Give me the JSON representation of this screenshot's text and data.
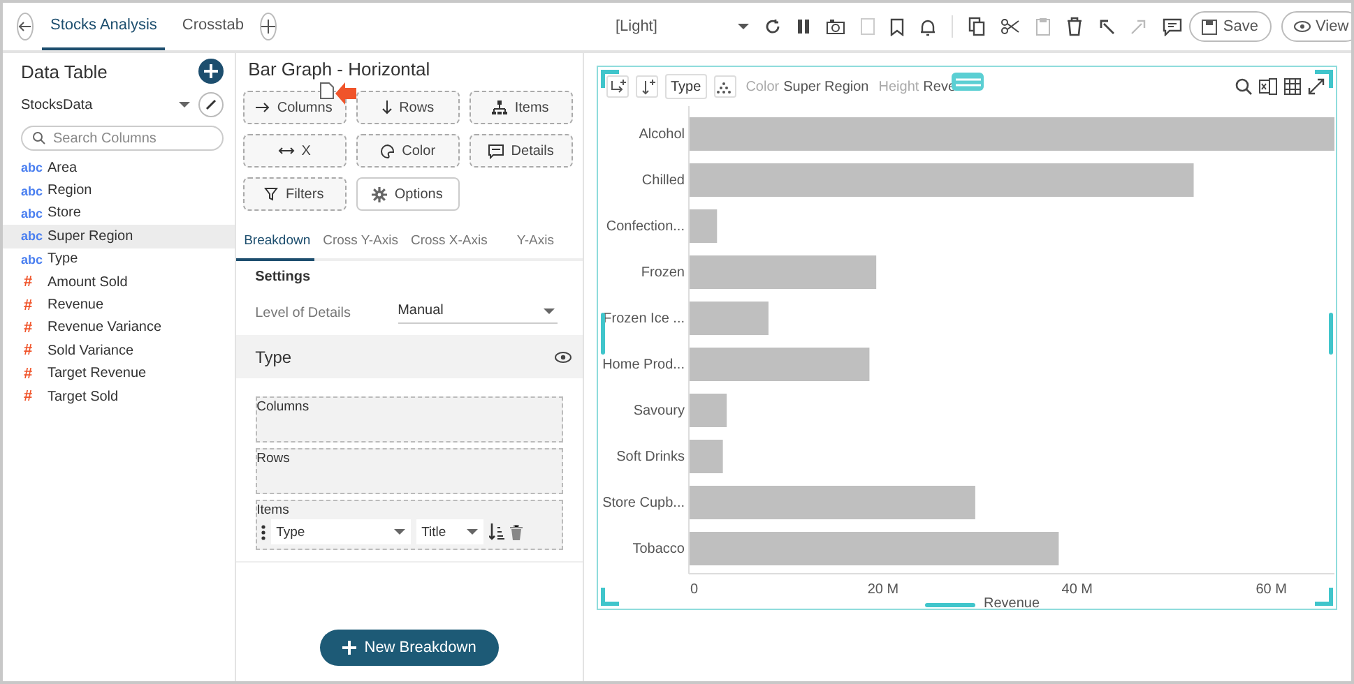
{
  "top_bar": {
    "tabs": [
      {
        "label": "Stocks Analysis",
        "selected": true
      },
      {
        "label": "Crosstab",
        "selected": false
      }
    ],
    "theme": "[Light]",
    "save": "Save",
    "view": "View"
  },
  "data_table": {
    "title": "Data Table",
    "source": "StocksData",
    "search": {
      "placeholder": "Search Columns"
    },
    "columns": [
      {
        "tag": "abc",
        "kind": "text",
        "name": "Area",
        "selected": false
      },
      {
        "tag": "abc",
        "kind": "text",
        "name": "Region",
        "selected": false
      },
      {
        "tag": "abc",
        "kind": "text",
        "name": "Store",
        "selected": false
      },
      {
        "tag": "abc",
        "kind": "text",
        "name": "Super Region",
        "selected": true
      },
      {
        "tag": "abc",
        "kind": "text",
        "name": "Type",
        "selected": false
      },
      {
        "tag": "#",
        "kind": "numeric",
        "name": "Amount Sold",
        "selected": false
      },
      {
        "tag": "#",
        "kind": "numeric",
        "name": "Revenue",
        "selected": false
      },
      {
        "tag": "#",
        "kind": "numeric",
        "name": "Revenue Variance",
        "selected": false
      },
      {
        "tag": "#",
        "kind": "numeric",
        "name": "Sold Variance",
        "selected": false
      },
      {
        "tag": "#",
        "kind": "numeric",
        "name": "Target Revenue",
        "selected": false
      },
      {
        "tag": "#",
        "kind": "numeric",
        "name": "Target Sold",
        "selected": false
      }
    ]
  },
  "editor": {
    "title": "Bar Graph - Horizontal",
    "drop_buttons": [
      {
        "label": "Columns",
        "kind": "drop"
      },
      {
        "label": "Rows",
        "kind": "drop"
      },
      {
        "label": "Items",
        "kind": "drop"
      },
      {
        "label": "X",
        "kind": "drop"
      },
      {
        "label": "Color",
        "kind": "drop"
      },
      {
        "label": "Details",
        "kind": "drop"
      },
      {
        "label": "Filters",
        "kind": "drop"
      },
      {
        "label": "Options",
        "kind": "menu"
      }
    ],
    "tabs": [
      {
        "label": "Breakdown",
        "selected": true
      },
      {
        "label": "Cross Y-Axis",
        "selected": false
      },
      {
        "label": "Cross X-Axis",
        "selected": false
      },
      {
        "label": "Y-Axis",
        "selected": false
      }
    ],
    "settings": {
      "heading": "Settings",
      "level_label": "Level of Details",
      "level_value": "Manual"
    },
    "section": {
      "title": "Type",
      "zones": [
        {
          "label": "Columns"
        },
        {
          "label": "Rows"
        },
        {
          "label": "Items",
          "items": [
            {
              "field": "Type",
              "label": "Title"
            }
          ]
        }
      ]
    },
    "new_breakdown": "New Breakdown"
  },
  "chart": {
    "header": {
      "type_button": "Type",
      "color_label": "Color",
      "color_value": "Super Region",
      "height_label": "Height",
      "height_value": "Reve"
    },
    "chart_data": {
      "type": "bar",
      "orientation": "horizontal",
      "xlabel": "Revenue",
      "categories": [
        "Alcohol",
        "Chilled",
        "Confection...",
        "Frozen",
        "Frozen Ice ...",
        "Home Prod...",
        "Savoury",
        "Soft Drinks",
        "Store Cupb...",
        "Tobacco"
      ],
      "series": [
        {
          "color": "#bfbfbf",
          "values": [
            66.5,
            52,
            2.9,
            19.3,
            8.2,
            18.6,
            3.9,
            3.5,
            29.5,
            38.1
          ]
        }
      ],
      "xlim": [
        0,
        66.5
      ],
      "xticks": [
        {
          "value": 0,
          "label": "0"
        },
        {
          "value": 20,
          "label": "20 M"
        },
        {
          "value": 40,
          "label": "40 M"
        },
        {
          "value": 60,
          "label": "60 M"
        }
      ]
    }
  }
}
